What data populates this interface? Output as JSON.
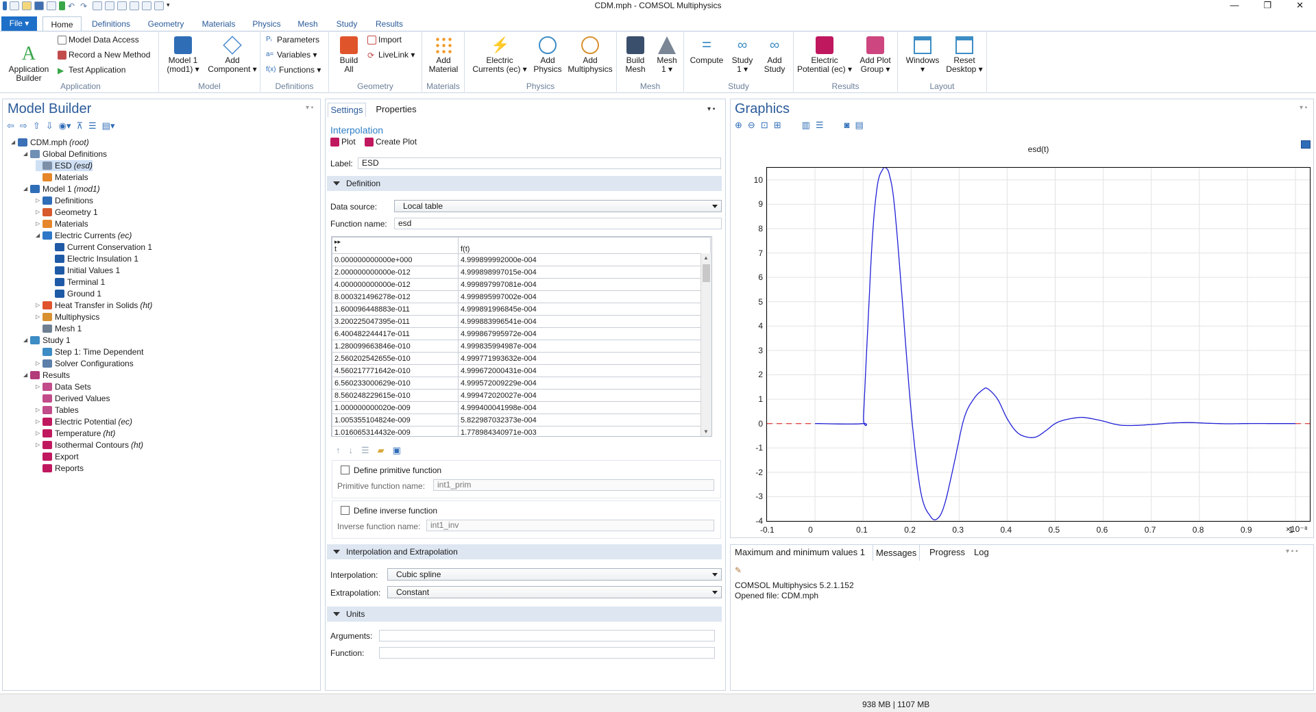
{
  "window": {
    "title": "CDM.mph - COMSOL Multiphysics",
    "min": "—",
    "max": "❐",
    "close": "✕"
  },
  "ribbon": {
    "file": "File ▾",
    "tabs": [
      "Home",
      "Definitions",
      "Geometry",
      "Materials",
      "Physics",
      "Mesh",
      "Study",
      "Results"
    ],
    "groups": {
      "application": {
        "label": "Application",
        "app_builder": "Application\nBuilder",
        "model_data_access": "Model Data Access",
        "record_method": "Record a New Method",
        "test_app": "Test Application"
      },
      "model": {
        "label": "Model",
        "model1": "Model 1\n(mod1) ▾",
        "add_component": "Add\nComponent ▾"
      },
      "definitions": {
        "label": "Definitions",
        "parameters": "Parameters",
        "variables": "Variables ▾",
        "functions": "Functions ▾"
      },
      "geometry": {
        "label": "Geometry",
        "build_all": "Build\nAll",
        "import": "Import",
        "livelink": "LiveLink ▾"
      },
      "materials": {
        "label": "Materials",
        "add_material": "Add\nMaterial"
      },
      "physics": {
        "label": "Physics",
        "electric_currents": "Electric\nCurrents (ec) ▾",
        "add_physics": "Add\nPhysics",
        "add_multiphysics": "Add\nMultiphysics"
      },
      "mesh": {
        "label": "Mesh",
        "build_mesh": "Build\nMesh",
        "mesh1": "Mesh\n1 ▾"
      },
      "study": {
        "label": "Study",
        "compute": "Compute",
        "study1": "Study\n1 ▾",
        "add_study": "Add\nStudy"
      },
      "results": {
        "label": "Results",
        "electric_potential": "Electric\nPotential (ec) ▾",
        "add_plot_group": "Add Plot\nGroup ▾"
      },
      "layout": {
        "label": "Layout",
        "windows": "Windows\n▾",
        "reset_desktop": "Reset\nDesktop ▾"
      }
    }
  },
  "model_builder": {
    "title": "Model Builder",
    "tree": [
      {
        "label": "CDM.mph",
        "suffix": "(root)",
        "level": 0,
        "arrow": "◢",
        "color": "#3b6fb6"
      },
      {
        "label": "Global Definitions",
        "suffix": "",
        "level": 1,
        "arrow": "◢",
        "color": "#6f8fb5"
      },
      {
        "label": "ESD",
        "suffix": "(esd)",
        "level": 2,
        "arrow": "",
        "color": "#7d90a8",
        "selected": true
      },
      {
        "label": "Materials",
        "suffix": "",
        "level": 2,
        "arrow": "",
        "color": "#e6862a"
      },
      {
        "label": "Model 1",
        "suffix": "(mod1)",
        "level": 1,
        "arrow": "◢",
        "color": "#2f6db7"
      },
      {
        "label": "Definitions",
        "suffix": "",
        "level": 2,
        "arrow": "▷",
        "color": "#2f6db7"
      },
      {
        "label": "Geometry 1",
        "suffix": "",
        "level": 2,
        "arrow": "▷",
        "color": "#d65a2c"
      },
      {
        "label": "Materials",
        "suffix": "",
        "level": 2,
        "arrow": "▷",
        "color": "#e6862a"
      },
      {
        "label": "Electric Currents",
        "suffix": "(ec)",
        "level": 2,
        "arrow": "◢",
        "color": "#2e78c7"
      },
      {
        "label": "Current Conservation 1",
        "suffix": "",
        "level": 3,
        "arrow": "",
        "color": "#1f5aa6"
      },
      {
        "label": "Electric Insulation 1",
        "suffix": "",
        "level": 3,
        "arrow": "",
        "color": "#1f5aa6"
      },
      {
        "label": "Initial Values 1",
        "suffix": "",
        "level": 3,
        "arrow": "",
        "color": "#1f5aa6"
      },
      {
        "label": "Terminal 1",
        "suffix": "",
        "level": 3,
        "arrow": "",
        "color": "#1f5aa6"
      },
      {
        "label": "Ground 1",
        "suffix": "",
        "level": 3,
        "arrow": "",
        "color": "#1f5aa6"
      },
      {
        "label": "Heat Transfer in Solids",
        "suffix": "(ht)",
        "level": 2,
        "arrow": "▷",
        "color": "#e0542c"
      },
      {
        "label": "Multiphysics",
        "suffix": "",
        "level": 2,
        "arrow": "▷",
        "color": "#d8912f"
      },
      {
        "label": "Mesh 1",
        "suffix": "",
        "level": 2,
        "arrow": "",
        "color": "#6f7f92"
      },
      {
        "label": "Study 1",
        "suffix": "",
        "level": 1,
        "arrow": "◢",
        "color": "#3c8cc5"
      },
      {
        "label": "Step 1: Time Dependent",
        "suffix": "",
        "level": 2,
        "arrow": "",
        "color": "#3c8cc5"
      },
      {
        "label": "Solver Configurations",
        "suffix": "",
        "level": 2,
        "arrow": "▷",
        "color": "#5b7fa8"
      },
      {
        "label": "Results",
        "suffix": "",
        "level": 1,
        "arrow": "◢",
        "color": "#b23b7a"
      },
      {
        "label": "Data Sets",
        "suffix": "",
        "level": 2,
        "arrow": "▷",
        "color": "#c24c8a"
      },
      {
        "label": "Derived Values",
        "suffix": "",
        "level": 2,
        "arrow": "",
        "color": "#c24c8a"
      },
      {
        "label": "Tables",
        "suffix": "",
        "level": 2,
        "arrow": "▷",
        "color": "#c24c8a"
      },
      {
        "label": "Electric Potential",
        "suffix": "(ec)",
        "level": 2,
        "arrow": "▷",
        "color": "#c0185f"
      },
      {
        "label": "Temperature",
        "suffix": "(ht)",
        "level": 2,
        "arrow": "▷",
        "color": "#c0185f"
      },
      {
        "label": "Isothermal Contours",
        "suffix": "(ht)",
        "level": 2,
        "arrow": "▷",
        "color": "#c0185f"
      },
      {
        "label": "Export",
        "suffix": "",
        "level": 2,
        "arrow": "",
        "color": "#c0185f"
      },
      {
        "label": "Reports",
        "suffix": "",
        "level": 2,
        "arrow": "",
        "color": "#c0185f"
      }
    ]
  },
  "settings": {
    "tabs": [
      "Settings",
      "Properties"
    ],
    "node_type": "Interpolation",
    "plot": "Plot",
    "create_plot": "Create Plot",
    "label_caption": "Label:",
    "label_value": "ESD",
    "definition": {
      "header": "Definition",
      "data_source_caption": "Data source:",
      "data_source_value": "Local table",
      "function_name_caption": "Function name:",
      "function_name_value": "esd",
      "columns": [
        "t",
        "f(t)"
      ],
      "rows": [
        [
          "0.000000000000e+000",
          "4.999899992000e-004"
        ],
        [
          "2.000000000000e-012",
          "4.999898997015e-004"
        ],
        [
          "4.000000000000e-012",
          "4.999897997081e-004"
        ],
        [
          "8.000321496278e-012",
          "4.999895997002e-004"
        ],
        [
          "1.600096448883e-011",
          "4.999891996845e-004"
        ],
        [
          "3.200225047395e-011",
          "4.999883996541e-004"
        ],
        [
          "6.400482244417e-011",
          "4.999867995972e-004"
        ],
        [
          "1.280099663846e-010",
          "4.999835994987e-004"
        ],
        [
          "2.560202542655e-010",
          "4.999771993632e-004"
        ],
        [
          "4.560217771642e-010",
          "4.999672000431e-004"
        ],
        [
          "6.560233000629e-010",
          "4.999572009229e-004"
        ],
        [
          "8.560248229615e-010",
          "4.999472020027e-004"
        ],
        [
          "1.000000000020e-009",
          "4.999400041998e-004"
        ],
        [
          "1.005355104824e-009",
          "5.822987032373e-004"
        ],
        [
          "1.016065314432e-009",
          "1.778984340971e-003"
        ]
      ],
      "define_primitive": "Define primitive function",
      "primitive_caption": "Primitive function name:",
      "primitive_value": "int1_prim",
      "define_inverse": "Define inverse function",
      "inverse_caption": "Inverse function name:",
      "inverse_value": "int1_inv"
    },
    "interp": {
      "header": "Interpolation and Extrapolation",
      "interp_caption": "Interpolation:",
      "interp_value": "Cubic spline",
      "extrap_caption": "Extrapolation:",
      "extrap_value": "Constant"
    },
    "units": {
      "header": "Units",
      "arguments_caption": "Arguments:",
      "function_caption": "Function:"
    }
  },
  "graphics": {
    "title": "Graphics",
    "exp": "×10⁻⁸"
  },
  "chart_data": {
    "type": "line",
    "title": "esd(t)",
    "xlabel": "",
    "ylabel": "",
    "xlim": [
      -0.1,
      1.03
    ],
    "ylim": [
      -4,
      10.5
    ],
    "x_ticks": [
      -0.1,
      0,
      0.1,
      0.2,
      0.3,
      0.4,
      0.5,
      0.6,
      0.7,
      0.8,
      0.9,
      1
    ],
    "y_ticks": [
      -4,
      -3,
      -2,
      -1,
      0,
      1,
      2,
      3,
      4,
      5,
      6,
      7,
      8,
      9,
      10
    ],
    "x_scale_label": "×10⁻⁸",
    "grid": true,
    "series": [
      {
        "line_color": "#1f1fd6",
        "style": "solid",
        "x": [
          0,
          0.1,
          0.101,
          0.11,
          0.12,
          0.13,
          0.14,
          0.147,
          0.155,
          0.165,
          0.18,
          0.2,
          0.22,
          0.24,
          0.255,
          0.27,
          0.29,
          0.31,
          0.33,
          0.35,
          0.36,
          0.38,
          0.4,
          0.42,
          0.44,
          0.46,
          0.48,
          0.5,
          0.52,
          0.55,
          0.57,
          0.6,
          0.63,
          0.66,
          0.7,
          0.74,
          0.78,
          0.82,
          0.86,
          0.9,
          0.95,
          1.0
        ],
        "y": [
          0,
          0,
          0.3,
          4,
          7.8,
          9.8,
          10.4,
          10.5,
          10.2,
          9.0,
          5.5,
          0.5,
          -2.8,
          -3.8,
          -3.9,
          -3.3,
          -1.6,
          0.2,
          1.0,
          1.4,
          1.42,
          1.0,
          0.2,
          -0.35,
          -0.55,
          -0.55,
          -0.3,
          0.0,
          0.15,
          0.25,
          0.22,
          0.1,
          -0.05,
          -0.08,
          -0.04,
          0.02,
          0.04,
          0.01,
          -0.01,
          0.0,
          0.0,
          0.0
        ]
      },
      {
        "line_color": "#e04848",
        "style": "dashed",
        "x": [
          -0.1,
          0
        ],
        "y": [
          0,
          0
        ]
      },
      {
        "line_color": "#e04848",
        "style": "dashed",
        "x": [
          1.0,
          1.03
        ],
        "y": [
          0,
          0
        ]
      }
    ]
  },
  "messages": {
    "tabs": [
      "Maximum and minimum values 1",
      "Messages",
      "Progress",
      "Log"
    ],
    "lines": [
      "COMSOL Multiphysics 5.2.1.152",
      "Opened file: CDM.mph"
    ]
  },
  "status": {
    "memory": "938 MB | 1107 MB"
  }
}
